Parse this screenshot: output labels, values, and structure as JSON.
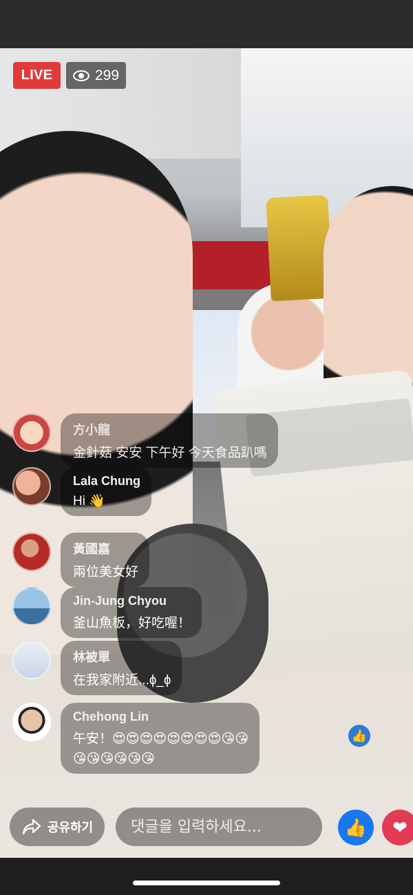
{
  "live": {
    "badge": "LIVE",
    "viewers": "299"
  },
  "comments": [
    {
      "name": "方小龍",
      "text": "金針菇 安安 下午好 今天食品趴嗎",
      "faint": true
    },
    {
      "name": "Lala Chung",
      "text": "Hi 👋"
    },
    {
      "name": "黃國嘉",
      "text": "兩位美女好"
    },
    {
      "name": "Jin-Jung Chyou",
      "text": "釜山魚板，好吃喔！"
    },
    {
      "name": "林被單",
      "text": "在我家附近...ɸ_ɸ"
    },
    {
      "name": "Chehong Lin",
      "text_line1": "午安！😍😍😍😍😍😍😍😍😘😘",
      "text_line2": "😘😘😘😘😘😘"
    }
  ],
  "bottom": {
    "share_label": "공유하기",
    "comment_placeholder": "댓글을 입력하세요..."
  },
  "icons": {
    "eye": "eye-icon",
    "share": "share-arrow-icon",
    "like": "thumbs-up-icon",
    "love": "heart-icon"
  },
  "colors": {
    "live_red": "#e13a3a",
    "like_blue": "#1877f2",
    "love_red": "#e33b53"
  }
}
